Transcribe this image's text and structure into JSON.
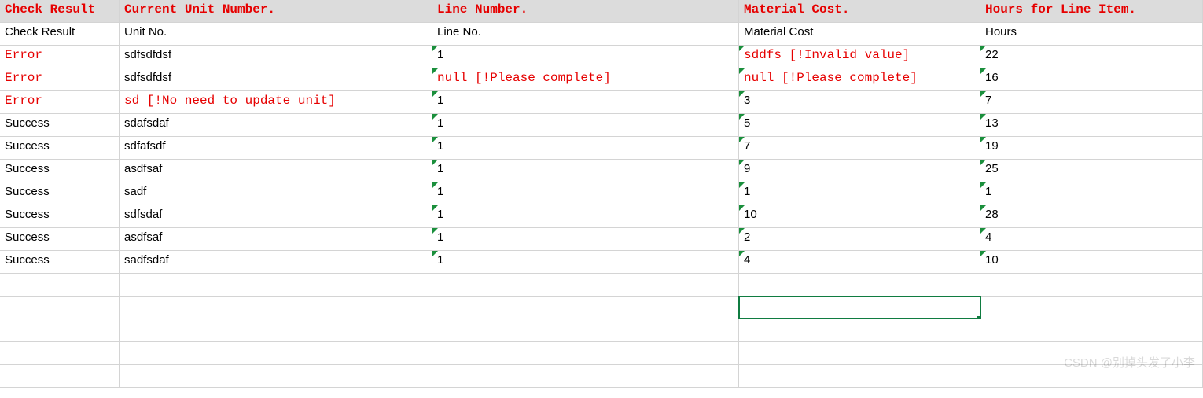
{
  "columns": {
    "headers_top": [
      "Check Result",
      "Current Unit Number.",
      "Line Number.",
      "Material Cost.",
      "Hours for Line Item."
    ],
    "headers_sub": [
      "Check Result",
      "Unit No.",
      "Line No.",
      "Material Cost",
      "Hours"
    ]
  },
  "rows": [
    {
      "status": "Error",
      "unit": "sdfsdfdsf",
      "unit_err": false,
      "line": "1",
      "line_err": false,
      "cost": "sddfs [!Invalid value]",
      "cost_err": true,
      "hours": "22"
    },
    {
      "status": "Error",
      "unit": "sdfsdfdsf",
      "unit_err": false,
      "line": "null [!Please complete]",
      "line_err": true,
      "cost": "null [!Please complete]",
      "cost_err": true,
      "hours": "16"
    },
    {
      "status": "Error",
      "unit": "sd [!No need to update unit]",
      "unit_err": true,
      "line": "1",
      "line_err": false,
      "cost": "3",
      "cost_err": false,
      "hours": "7"
    },
    {
      "status": "Success",
      "unit": "sdafsdaf",
      "unit_err": false,
      "line": "1",
      "line_err": false,
      "cost": "5",
      "cost_err": false,
      "hours": "13"
    },
    {
      "status": "Success",
      "unit": "sdfafsdf",
      "unit_err": false,
      "line": "1",
      "line_err": false,
      "cost": "7",
      "cost_err": false,
      "hours": "19"
    },
    {
      "status": "Success",
      "unit": "asdfsaf",
      "unit_err": false,
      "line": "1",
      "line_err": false,
      "cost": "9",
      "cost_err": false,
      "hours": "25"
    },
    {
      "status": "Success",
      "unit": "sadf",
      "unit_err": false,
      "line": "1",
      "line_err": false,
      "cost": "1",
      "cost_err": false,
      "hours": "1"
    },
    {
      "status": "Success",
      "unit": "sdfsdaf",
      "unit_err": false,
      "line": "1",
      "line_err": false,
      "cost": "10",
      "cost_err": false,
      "hours": "28"
    },
    {
      "status": "Success",
      "unit": "asdfsaf",
      "unit_err": false,
      "line": "1",
      "line_err": false,
      "cost": "2",
      "cost_err": false,
      "hours": "4"
    },
    {
      "status": "Success",
      "unit": "sadfsdaf",
      "unit_err": false,
      "line": "1",
      "line_err": false,
      "cost": "4",
      "cost_err": false,
      "hours": "10"
    }
  ],
  "empty_rows": 5,
  "selected_cell": {
    "row_index_empty": 1,
    "col": 3
  },
  "watermark": "CSDN @别掉头发了小李"
}
